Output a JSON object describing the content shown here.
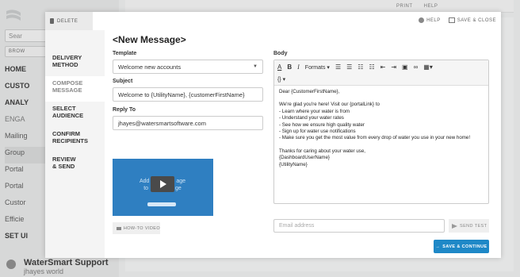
{
  "background": {
    "logo_text": "nart",
    "search_placeholder": "Sear",
    "browse_label": "BROW",
    "nav": [
      "HOME",
      "CUSTO",
      "ANALY",
      "ENGA",
      "Mailing",
      "Group",
      "Portal",
      "Portal",
      "Custor",
      "Efficie",
      "SET UI"
    ],
    "footer_name": "WaterSmart Support",
    "footer_sub": "jhayes world",
    "top_print": "PRINT",
    "top_help": "HELP"
  },
  "modal": {
    "delete_label": "DELETE",
    "help_label": "HELP",
    "save_close_label": "SAVE & CLOSE",
    "wizard_steps": [
      {
        "label_1": "DELIVERY",
        "label_2": "METHOD"
      },
      {
        "label_1": "COMPOSE",
        "label_2": "MESSAGE"
      },
      {
        "label_1": "SELECT",
        "label_2": "AUDIENCE"
      },
      {
        "label_1": "CONFIRM",
        "label_2": "RECIPIENTS"
      },
      {
        "label_1": "REVIEW",
        "label_2": "& SEND"
      }
    ],
    "title": "<New Message>",
    "template_label": "Template",
    "template_value": "Welcome new accounts",
    "subject_label": "Subject",
    "subject_value": "Welcome to {UtilityName}, {customerFirstName}",
    "reply_to_label": "Reply To",
    "reply_to_value": "jhayes@watersmartsoftware.com",
    "video_text_1": "Add",
    "video_text_2": "age",
    "video_text_3": "to",
    "video_text_4": "ge",
    "how_to_label": "HOW-TO VIDEO",
    "body_label": "Body",
    "toolbar": {
      "font_color": "A",
      "bold": "B",
      "italic": "I",
      "formats": "Formats",
      "source": "{}"
    },
    "body_lines": [
      "Dear {CustomerFirstName},",
      "",
      "We're glad you're here! Visit our {portalLink} to",
      "- Learn where your water is from",
      "- Understand your water rates",
      "- See how we ensure high quality water",
      "- Sign up for water use notifications",
      "- Make sure you get the most value from every drop of water you use in your new home!",
      "",
      "Thanks for caring about your water use,",
      "{DashboardUserName}",
      "{UtilityName}"
    ],
    "email_placeholder": "Email address",
    "send_test_label": "SEND TEST",
    "save_continue_label": "SAVE & CONTINUE"
  },
  "colors": {
    "accent": "#1e88c7",
    "video_bg": "#2f7fc1"
  }
}
